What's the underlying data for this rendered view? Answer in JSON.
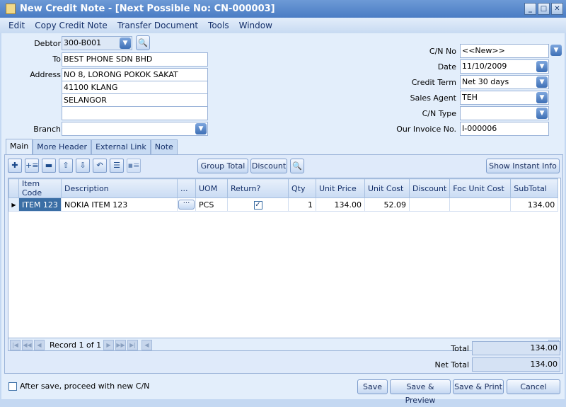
{
  "window": {
    "title": "New Credit Note - [Next Possible No: CN-000003]"
  },
  "menu": [
    "Edit",
    "Copy Credit Note",
    "Transfer Document",
    "Tools",
    "Window"
  ],
  "header": {
    "debtor_label": "Debtor",
    "debtor": "300-B001",
    "to_label": "To",
    "to": "BEST PHONE SDN BHD",
    "address_label": "Address",
    "address": [
      "NO 8, LORONG POKOK SAKAT",
      "41100 KLANG",
      "SELANGOR",
      ""
    ],
    "branch_label": "Branch",
    "branch": "",
    "cn_no_label": "C/N No",
    "cn_no": "<<New>>",
    "date_label": "Date",
    "date": "11/10/2009",
    "credit_term_label": "Credit Term",
    "credit_term": "Net 30 days",
    "sales_agent_label": "Sales Agent",
    "sales_agent": "TEH",
    "cn_type_label": "C/N Type",
    "cn_type": "",
    "invoice_label": "Our Invoice No.",
    "invoice": "I-000006"
  },
  "tabs": [
    "Main",
    "More Header",
    "External Link",
    "Note"
  ],
  "toolbar": {
    "group_total": "Group Total",
    "discount": "Discount",
    "instant_info": "Show Instant Info"
  },
  "grid": {
    "columns": [
      "Item Code",
      "Description",
      "...",
      "UOM",
      "Return?",
      "Qty",
      "Unit Price",
      "Unit Cost",
      "Discount",
      "Foc Unit Cost",
      "SubTotal"
    ],
    "rows": [
      {
        "item_code": "ITEM 123",
        "description": "NOKIA ITEM 123",
        "uom": "PCS",
        "return": true,
        "qty": "1",
        "unit_price": "134.00",
        "unit_cost": "52.09",
        "discount": "",
        "foc_unit_cost": "",
        "subtotal": "134.00"
      }
    ]
  },
  "nav": {
    "record": "Record 1 of 1"
  },
  "totals": {
    "total_label": "Total",
    "total": "134.00",
    "net_label": "Net Total",
    "net": "134.00"
  },
  "footer": {
    "proceed": "After save, proceed with new C/N",
    "save": "Save",
    "save_preview": "Save & Preview",
    "save_print": "Save & Print",
    "cancel": "Cancel"
  }
}
